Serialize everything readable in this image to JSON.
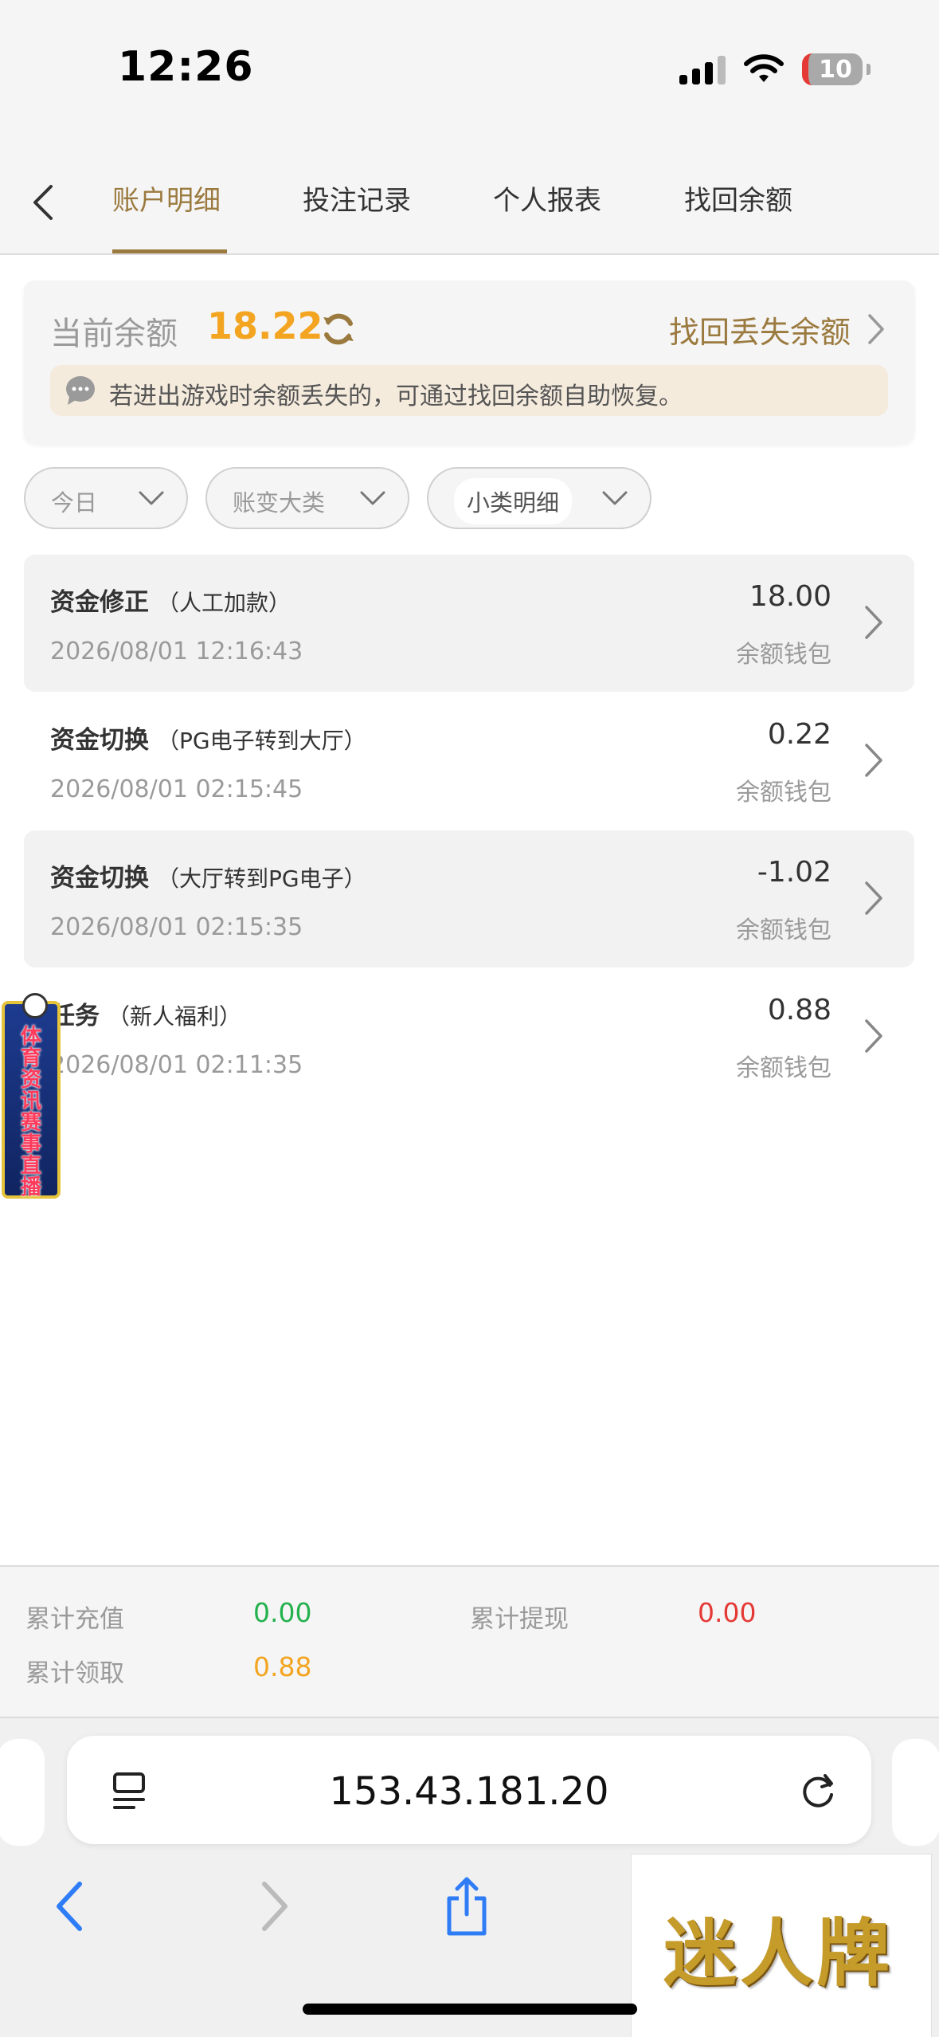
{
  "status_bar": {
    "time": "12:26",
    "battery": "10"
  },
  "tabs": [
    {
      "label": "账户明细",
      "active": true
    },
    {
      "label": "投注记录",
      "active": false
    },
    {
      "label": "个人报表",
      "active": false
    },
    {
      "label": "找回余额",
      "active": false
    }
  ],
  "balance": {
    "label": "当前余额",
    "value": "18.22",
    "recover_link": "找回丢失余额",
    "notice": "若进出游戏时余额丢失的，可通过找回余额自助恢复。"
  },
  "filters": {
    "date": "今日",
    "category": "账变大类",
    "subcategory": "小类明细"
  },
  "transactions": [
    {
      "title": "资金修正",
      "sub": "（人工加款）",
      "time": "2026/08/01 12:16:43",
      "amount": "18.00",
      "wallet": "余额钱包"
    },
    {
      "title": "资金切换",
      "sub": "（PG电子转到大厅）",
      "time": "2026/08/01 02:15:45",
      "amount": "0.22",
      "wallet": "余额钱包"
    },
    {
      "title": "资金切换",
      "sub": "（大厅转到PG电子）",
      "time": "2026/08/01 02:15:35",
      "amount": "-1.02",
      "wallet": "余额钱包"
    },
    {
      "title": "任务",
      "sub": "（新人福利）",
      "time": "2026/08/01 02:11:35",
      "amount": "0.88",
      "wallet": "余额钱包"
    }
  ],
  "float_banner": {
    "text": "体育资讯赛事直播"
  },
  "summary": {
    "deposit_label": "累计充值",
    "deposit_value": "0.00",
    "withdraw_label": "累计提现",
    "withdraw_value": "0.00",
    "claim_label": "累计领取",
    "claim_value": "0.88"
  },
  "browser": {
    "url": "153.43.181.20"
  },
  "logo": {
    "text": "迷人牌"
  },
  "colors": {
    "accent": "#9b7a3f",
    "balance": "#f3a521",
    "green": "#22b14c",
    "red": "#e53935"
  }
}
